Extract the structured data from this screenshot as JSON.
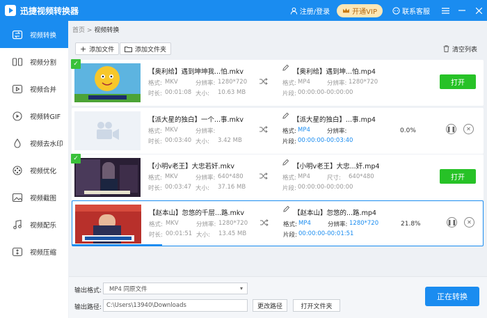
{
  "app": {
    "title": "迅捷视频转换器"
  },
  "header": {
    "login": "注册/登录",
    "vip": "开通VIP",
    "service": "联系客服"
  },
  "sidebar": {
    "items": [
      {
        "label": "视频转换"
      },
      {
        "label": "视频分割"
      },
      {
        "label": "视频合并"
      },
      {
        "label": "视频转GIF"
      },
      {
        "label": "视频去水印"
      },
      {
        "label": "视频优化"
      },
      {
        "label": "视频截图"
      },
      {
        "label": "视频配乐"
      },
      {
        "label": "视频压缩"
      }
    ]
  },
  "breadcrumb": {
    "home": "首页",
    "sep": ">",
    "current": "视频转换"
  },
  "toolbar": {
    "add_file": "添加文件",
    "add_folder": "添加文件夹",
    "clear_list": "清空列表"
  },
  "labels": {
    "format": "格式:",
    "resolution": "分辨率:",
    "duration": "时长:",
    "size": "大小:",
    "clip": "片段:",
    "dimension": "尺寸:",
    "open": "打开"
  },
  "files": [
    {
      "src_name": "【奥利给】遇到坤坤我...怕.mkv",
      "src_format": "MKV",
      "src_res": "1280*720",
      "src_duration": "00:01:08",
      "src_size": "10.63 MB",
      "dst_name": "【奥利给】遇到坤...怕.mp4",
      "dst_format": "MP4",
      "dst_res": "1280*720",
      "clip": "00:00:00-00:00:00",
      "status": "done"
    },
    {
      "src_name": "【派大星的独白】一个...事.mkv",
      "src_format": "MKV",
      "src_res": "",
      "src_duration": "00:03:40",
      "src_size": "3.42 MB",
      "dst_name": "【派大星的独白】...事.mp4",
      "dst_format": "MP4",
      "dst_res": "",
      "clip": "00:00:00-00:03:40",
      "status": "converting",
      "percent": "0.0%",
      "progress": 0.0
    },
    {
      "src_name": "【小明v老王】大忠若奸.mkv",
      "src_format": "MKV",
      "src_res": "640*480",
      "src_duration": "00:03:47",
      "src_size": "37.16 MB",
      "dst_name": "【小明v老王】大忠...奸.mp4",
      "dst_format": "MP4",
      "dst_res": "640*480",
      "clip": "00:00:00-00:00:00",
      "status": "done"
    },
    {
      "src_name": "【赵本山】忽悠的千层...路.mkv",
      "src_format": "MKV",
      "src_res": "1280*720",
      "src_duration": "00:01:51",
      "src_size": "13.45 MB",
      "dst_name": "【赵本山】忽悠的...路.mp4",
      "dst_format": "MP4",
      "dst_res": "1280*720",
      "clip": "00:00:00-00:01:51",
      "status": "converting",
      "percent": "21.8%",
      "progress": 0.218
    }
  ],
  "bottom": {
    "format_label": "输出格式:",
    "format_value": "MP4  同原文件",
    "path_label": "输出路径:",
    "path_value": "C:\\Users\\13940\\Downloads",
    "change_path": "更改路径",
    "open_folder": "打开文件夹",
    "convert": "正在转换"
  },
  "colors": {
    "accent": "#1a8cf0",
    "success": "#27c227",
    "vip_bg": "#fde7b6"
  }
}
